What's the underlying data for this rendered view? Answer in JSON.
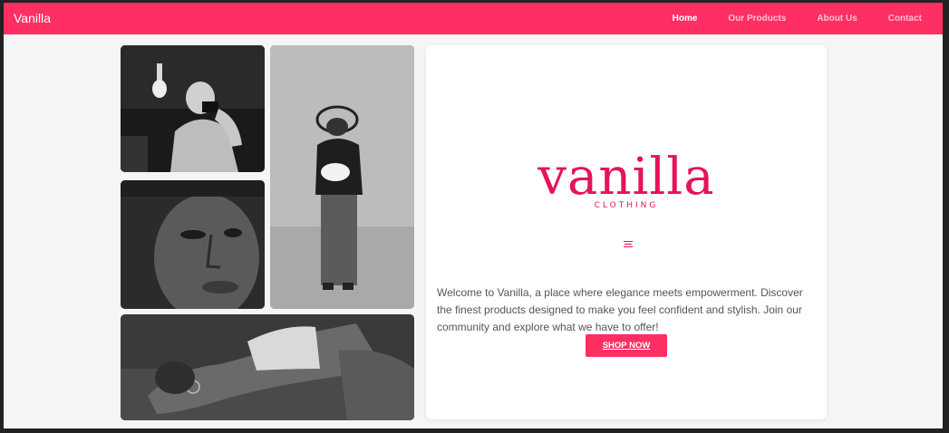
{
  "navbar": {
    "brand": "Vanilla",
    "links": [
      {
        "label": "Home",
        "active": true
      },
      {
        "label": "Our Products",
        "active": false
      },
      {
        "label": "About Us",
        "active": false
      },
      {
        "label": "Contact",
        "active": false
      }
    ]
  },
  "gallery": {
    "images": [
      {
        "subject": "woman with camera"
      },
      {
        "subject": "woman in hat holding flowers"
      },
      {
        "subject": "close-up portrait"
      },
      {
        "subject": "woman leaning back"
      }
    ]
  },
  "hero": {
    "logo_word": "vanilla",
    "logo_subtitle": "CLOTHING",
    "description": "Welcome to Vanilla, a place where elegance meets empowerment. Discover the finest products designed to make you feel confident and stylish. Join our community and explore what we have to offer!",
    "cta_label": "SHOP NOW"
  },
  "colors": {
    "accent": "#ff2e63",
    "logo": "#e5135a",
    "background": "#f5f5f5"
  }
}
